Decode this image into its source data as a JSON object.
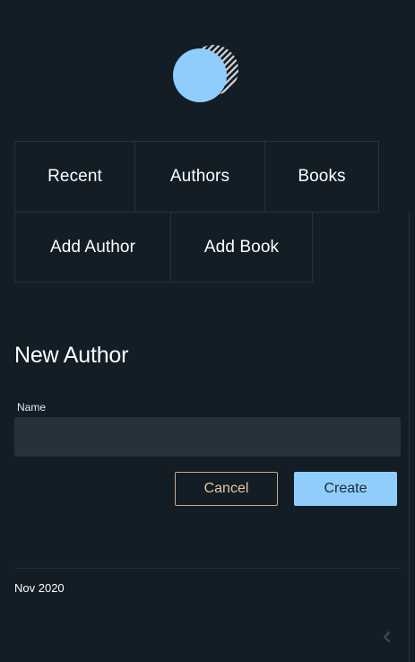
{
  "colors": {
    "background": "#121d25",
    "accent": "#8fcdfc",
    "cancel_accent": "#e9c6a3",
    "input_background": "#25323c"
  },
  "logo": {
    "icon": "logo-circle-icon"
  },
  "nav": {
    "recent": "Recent",
    "authors": "Authors",
    "books": "Books",
    "add_author": "Add Author",
    "add_book": "Add Book"
  },
  "form": {
    "title": "New Author",
    "name_label": "Name",
    "name_value": "",
    "name_placeholder": "",
    "cancel_label": "Cancel",
    "create_label": "Create"
  },
  "footer": {
    "date": "Nov 2020"
  },
  "icons": {
    "collapse": "chevron-left-icon"
  }
}
